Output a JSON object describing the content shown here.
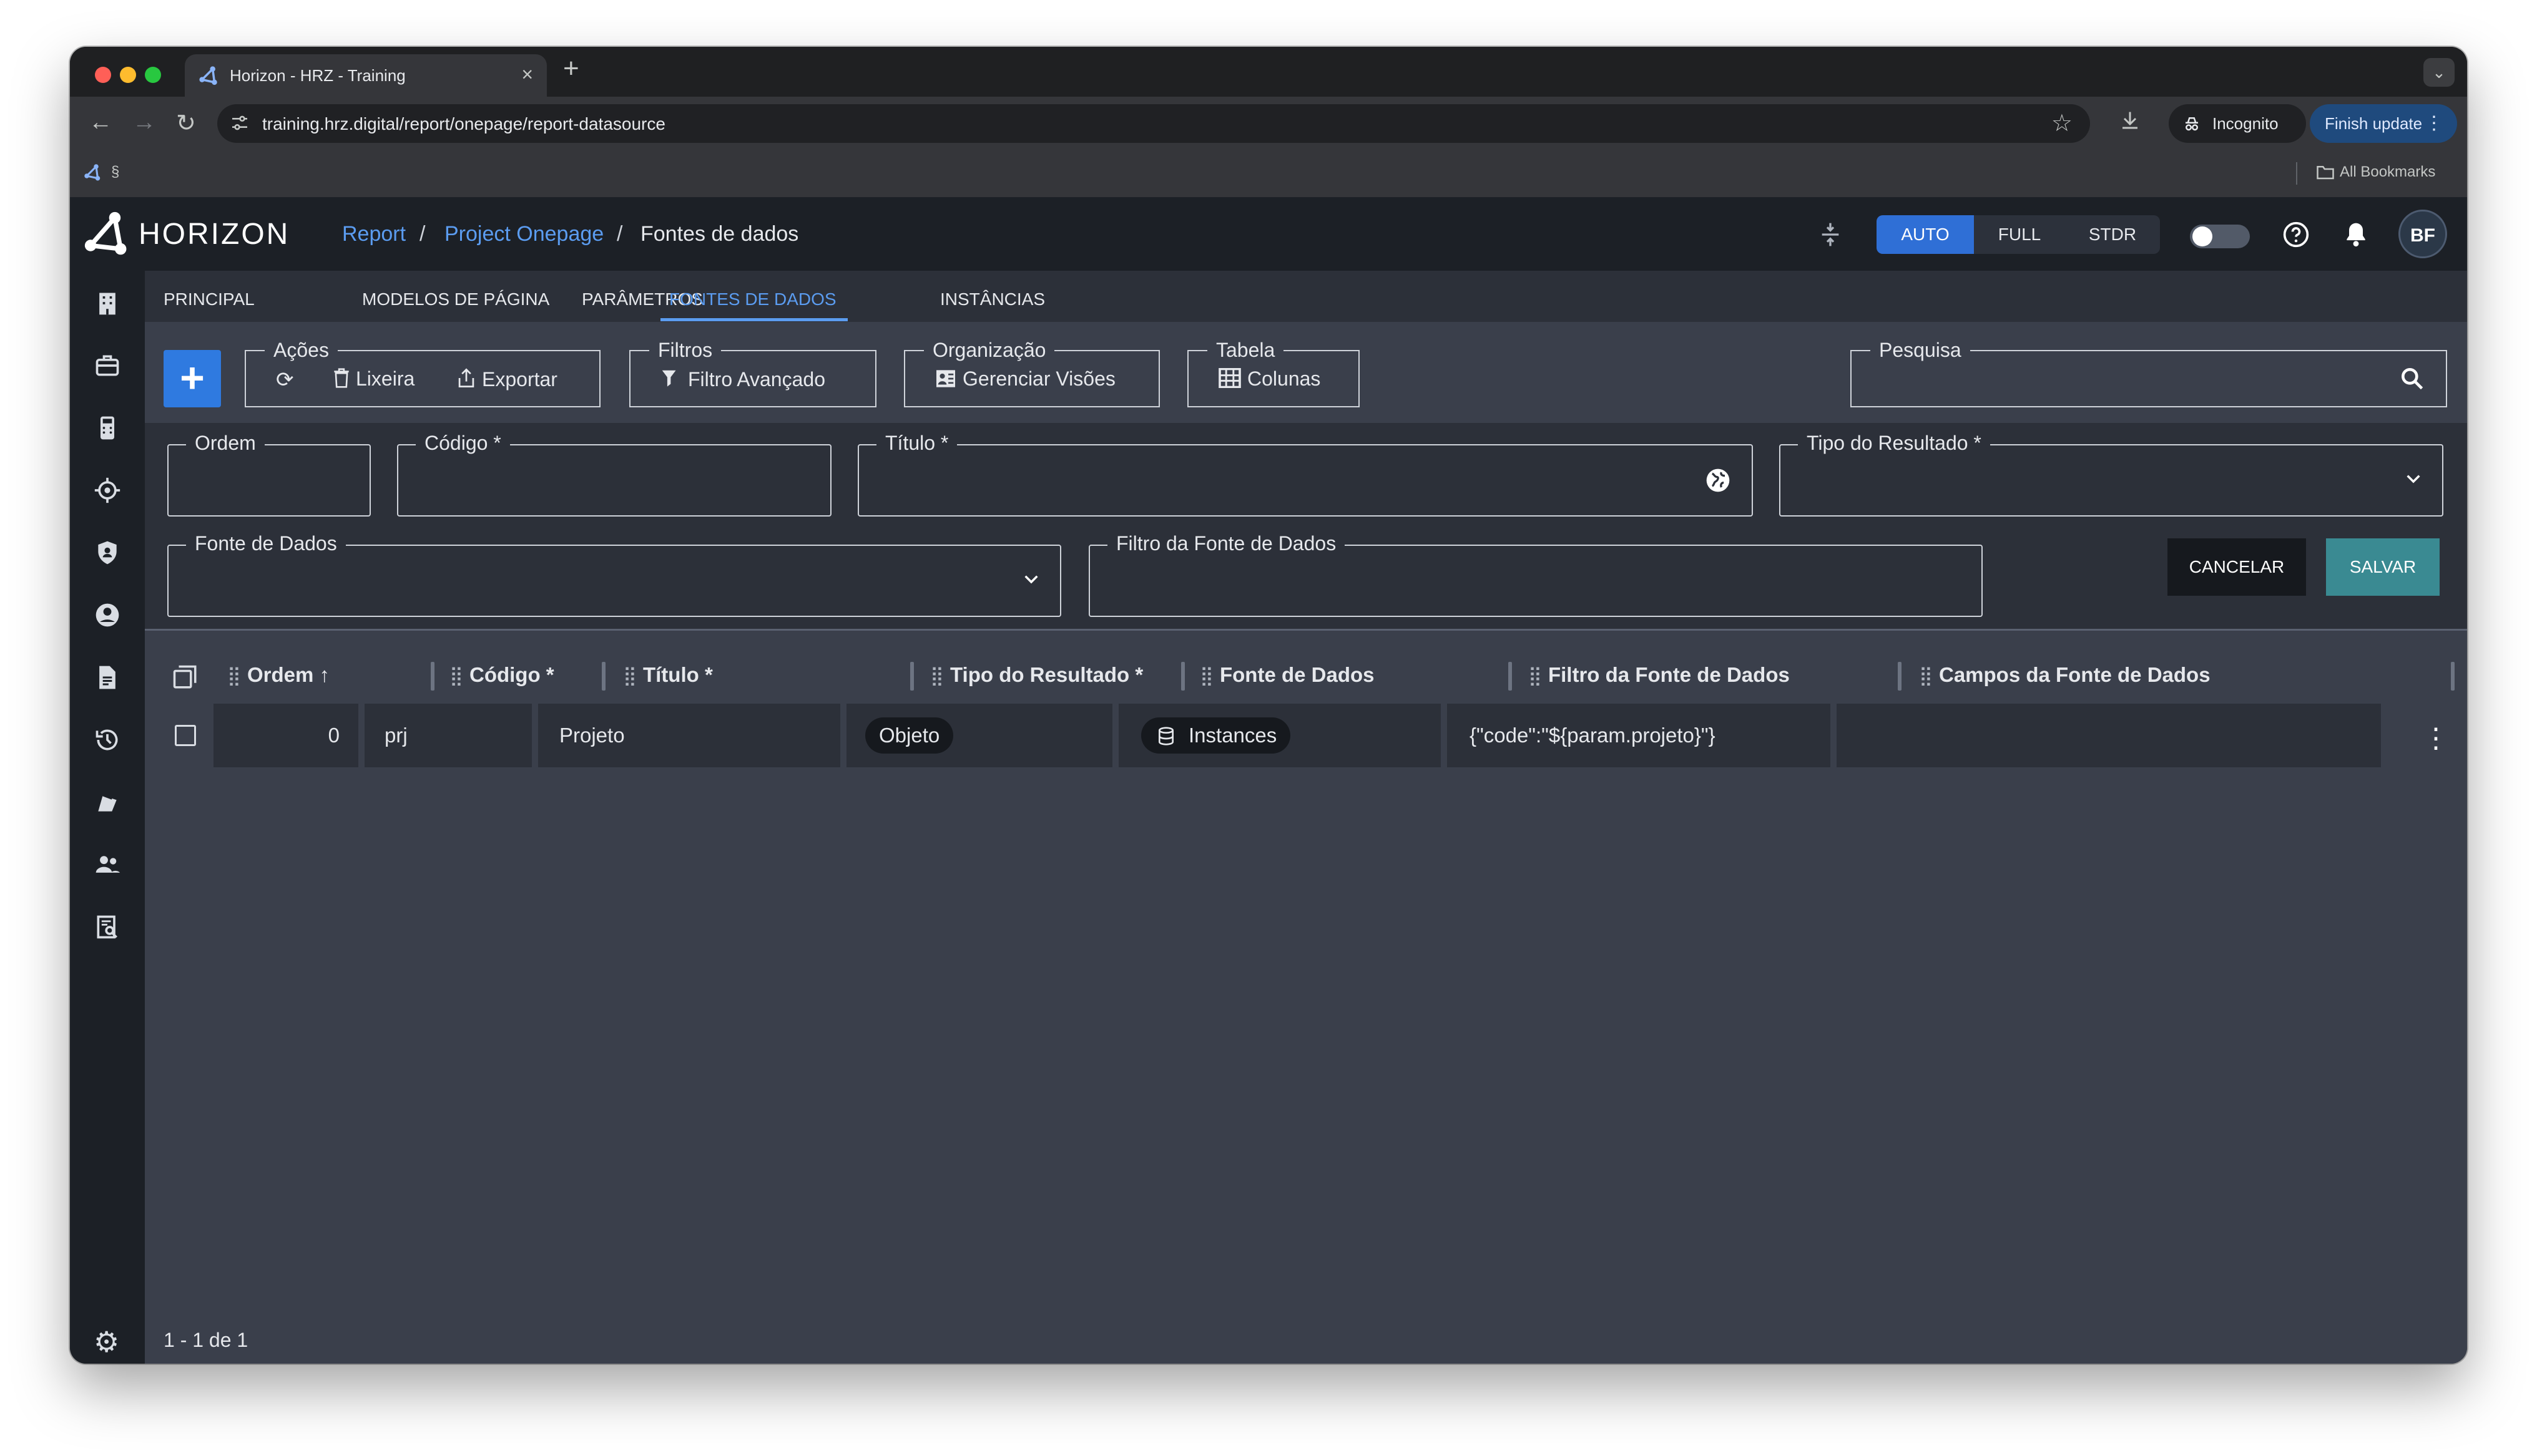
{
  "browser": {
    "tab_title": "Horizon - HRZ - Training",
    "tab_close": "×",
    "new_tab": "+",
    "tabs_menu": "⌄",
    "back": "←",
    "forward": "→",
    "reload": "↻",
    "url": "training.hrz.digital/report/onepage/report-datasource",
    "star": "☆",
    "incognito_label": "Incognito",
    "finish_update_label": "Finish update",
    "bookmark_section": "§",
    "all_bookmarks": "All Bookmarks"
  },
  "header": {
    "logo_text": "HORIZON",
    "breadcrumb": [
      "Report",
      "Project Onepage",
      "Fontes de dados"
    ],
    "breadcrumb_sep": "/",
    "modes": [
      "AUTO",
      "FULL",
      "STDR"
    ],
    "active_mode": "AUTO",
    "avatar_initials": "BF",
    "help_icon": "?",
    "notifications_icon": "🔔"
  },
  "sidebar": {
    "icons": [
      "building-icon",
      "briefcase-icon",
      "calculator-icon",
      "crosshair-icon",
      "shield-icon",
      "account-icon",
      "document-icon",
      "history-icon",
      "paint-icon",
      "group-icon",
      "report-search-icon"
    ],
    "settings_icon": "⚙"
  },
  "subtabs": [
    "PRINCIPAL",
    "MODELOS DE PÁGINA",
    "PARÂMETROS",
    "FONTES DE DADOS",
    "INSTÂNCIAS"
  ],
  "active_subtab": "FONTES DE DADOS",
  "actions": {
    "add_label": "+",
    "acoes_label": "Ações",
    "lixeira_label": "Lixeira",
    "exportar_label": "Exportar",
    "filtros_label": "Filtros",
    "filtro_avancado_label": "Filtro Avançado",
    "organizacao_label": "Organização",
    "gerenciar_visoes_label": "Gerenciar Visões",
    "tabela_label": "Tabela",
    "colunas_label": "Colunas",
    "pesquisa_label": "Pesquisa"
  },
  "form": {
    "ordem_label": "Ordem",
    "codigo_label": "Código *",
    "titulo_label": "Título *",
    "tipo_resultado_label": "Tipo do Resultado *",
    "fonte_dados_label": "Fonte de Dados",
    "filtro_fonte_label": "Filtro da Fonte de Dados",
    "cancel_label": "CANCELAR",
    "save_label": "SALVAR"
  },
  "table": {
    "columns": [
      "Ordem",
      "Código *",
      "Título *",
      "Tipo do Resultado *",
      "Fonte de Dados",
      "Filtro da Fonte de Dados",
      "Campos da Fonte de Dados"
    ],
    "sort_indicator": "↑",
    "rows": [
      {
        "ordem": "0",
        "codigo": "prj",
        "titulo": "Projeto",
        "tipo": "Objeto",
        "fonte": "Instances",
        "filtro": "{\"code\":\"${param.projeto}\"}",
        "campos": ""
      }
    ],
    "kebab": "⋮",
    "pagination": "1 - 1 de 1"
  },
  "colors": {
    "accent": "#2f7ae0",
    "link": "#5b9cf0",
    "save": "#3a8a92",
    "header_bg": "#1c2026",
    "content_bg": "#3a3f4b"
  }
}
